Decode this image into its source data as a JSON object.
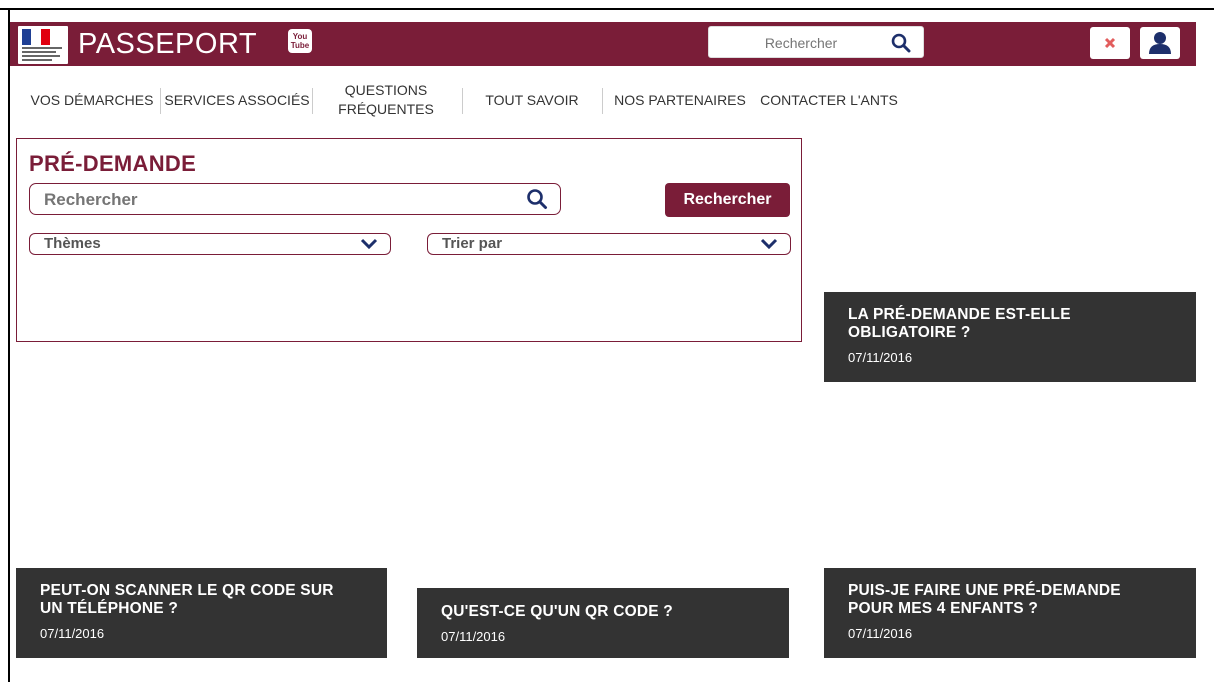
{
  "header": {
    "site_title": "PASSEPORT",
    "youtube_icon": "youtube-icon",
    "search_placeholder": "Rechercher",
    "brand_color": "#7a1d38"
  },
  "nav": {
    "items": [
      {
        "label": "VOS DÉMARCHES"
      },
      {
        "label": "SERVICES ASSOCIÉS"
      },
      {
        "label_line1": "QUESTIONS",
        "label_line2": "FRÉQUENTES"
      },
      {
        "label": "TOUT SAVOIR"
      },
      {
        "label": "NOS PARTENAIRES"
      },
      {
        "label": "CONTACTER L'ANTS"
      }
    ]
  },
  "predemande": {
    "title": "PRÉ-DEMANDE",
    "search_placeholder": "Rechercher",
    "search_button": "Rechercher",
    "themes_label": "Thèmes",
    "sort_label": "Trier par"
  },
  "cards": [
    {
      "title_line1": "LA PRÉ-DEMANDE EST-ELLE",
      "title_line2": "OBLIGATOIRE ?",
      "date": "07/11/2016"
    },
    {
      "title_line1": "PEUT-ON SCANNER LE QR CODE SUR",
      "title_line2": "UN TÉLÉPHONE ?",
      "date": "07/11/2016"
    },
    {
      "title_line1": "QU'EST-CE QU'UN QR CODE ?",
      "date": "07/11/2016"
    },
    {
      "title_line1": "PUIS-JE FAIRE UNE PRÉ-DEMANDE",
      "title_line2": "POUR MES 4 ENFANTS ?",
      "date": "07/11/2016"
    }
  ]
}
